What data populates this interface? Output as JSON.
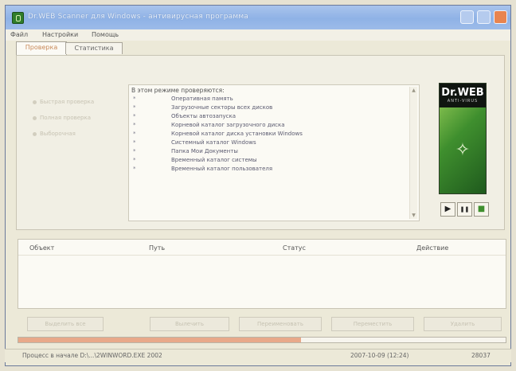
{
  "window": {
    "title": "Dr.WEB Scanner для Windows - антивирусная программа",
    "controls": {
      "minimize": "minimize-icon",
      "maximize": "maximize-icon",
      "close": "close-icon"
    }
  },
  "menu": [
    "Файл",
    "Настройки",
    "Помощь"
  ],
  "tabs": [
    "Проверка",
    "Статистика"
  ],
  "scan_modes": [
    "Быстрая проверка",
    "Полная проверка",
    "Выборочная"
  ],
  "log": {
    "title": "В этом режиме проверяются:",
    "items": [
      "Оперативная память",
      "Загрузочные секторы всех дисков",
      "Объекты автозапуска",
      "Корневой каталог загрузочного диска",
      "Корневой каталог диска установки Windows",
      "Системный каталог Windows",
      "Папка Мои Документы",
      "Временный каталог системы",
      "Временный каталог пользователя"
    ]
  },
  "brand": {
    "name": "Dr.WEB",
    "subtitle": "ANTI-VIRUS"
  },
  "controls": {
    "start": "▶",
    "pause": "❚❚",
    "stop": "■"
  },
  "results": {
    "columns": [
      "Объект",
      "Путь",
      "Статус",
      "Действие"
    ],
    "rows": []
  },
  "actions": [
    "Выделить все",
    "Вылечить",
    "Переименовать",
    "Переместить",
    "Удалить"
  ],
  "progress": {
    "fraction": 0.58
  },
  "statusbar": {
    "left": "Процесс в начале D:\\...\\2WINWORD.EXE 2002",
    "date": "2007-10-09 (12:24)",
    "count": "28037"
  },
  "colors": {
    "accent": "#e8a98a",
    "title_bar": "#8fb2e6",
    "brand_green": "#3f8f2e"
  }
}
